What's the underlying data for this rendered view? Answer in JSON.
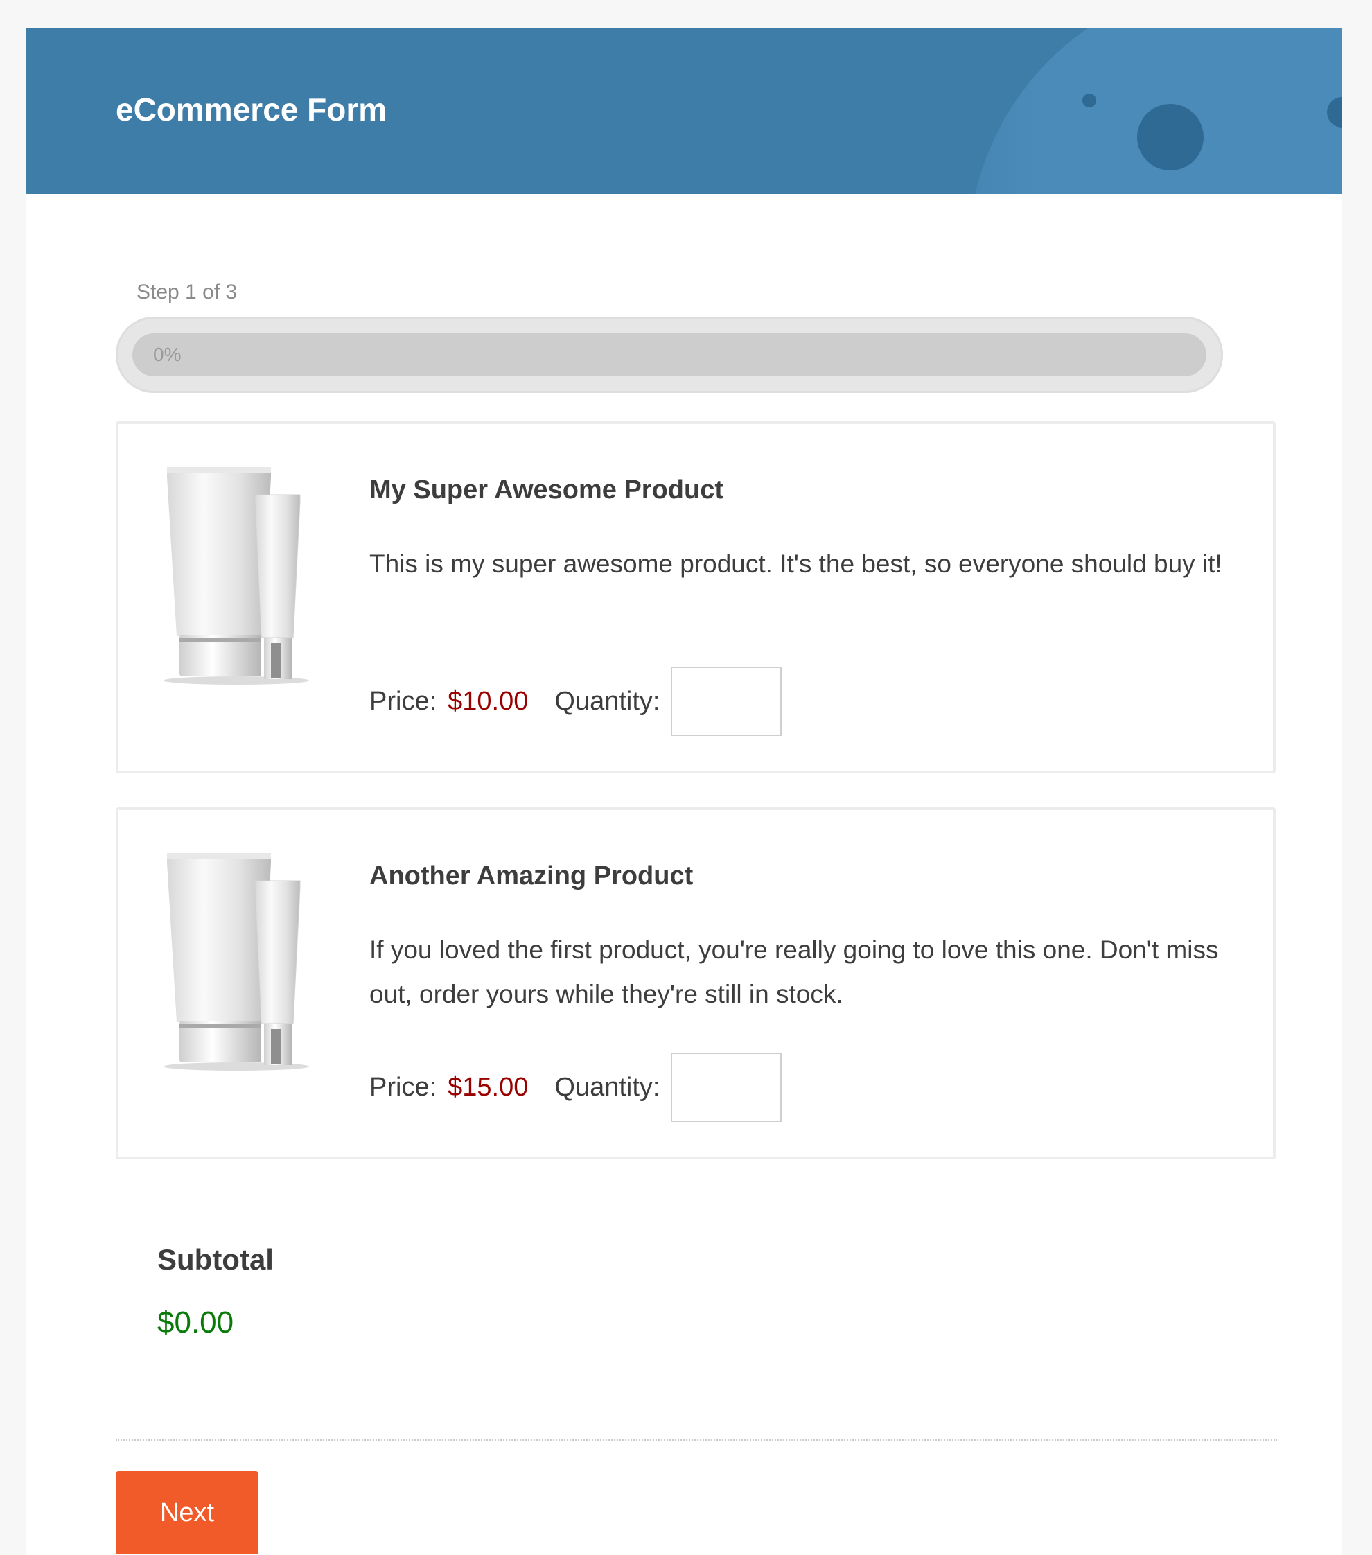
{
  "header": {
    "title": "eCommerce Form"
  },
  "progress": {
    "step_label": "Step 1 of 3",
    "percent": 0,
    "percent_label": "0%"
  },
  "products": [
    {
      "name": "My Super Awesome Product",
      "description": "This is my super awesome product. It's the best, so everyone should buy it!",
      "price_label": "Price:",
      "price": "$10.00",
      "quantity_label": "Quantity:",
      "quantity_value": "",
      "image_icon": "cosmetic-tubes-image"
    },
    {
      "name": "Another Amazing Product",
      "description": "If you loved the first product, you're really going to love this one. Don't miss out, order yours while they're still in stock.",
      "price_label": "Price:",
      "price": "$15.00",
      "quantity_label": "Quantity:",
      "quantity_value": "",
      "image_icon": "cosmetic-tubes-image"
    }
  ],
  "subtotal": {
    "label": "Subtotal",
    "value": "$0.00"
  },
  "actions": {
    "next_label": "Next"
  },
  "colors": {
    "header": "#3e7da8",
    "price": "#990000",
    "subtotal": "#0a7a0a",
    "next_button": "#f15a29"
  }
}
